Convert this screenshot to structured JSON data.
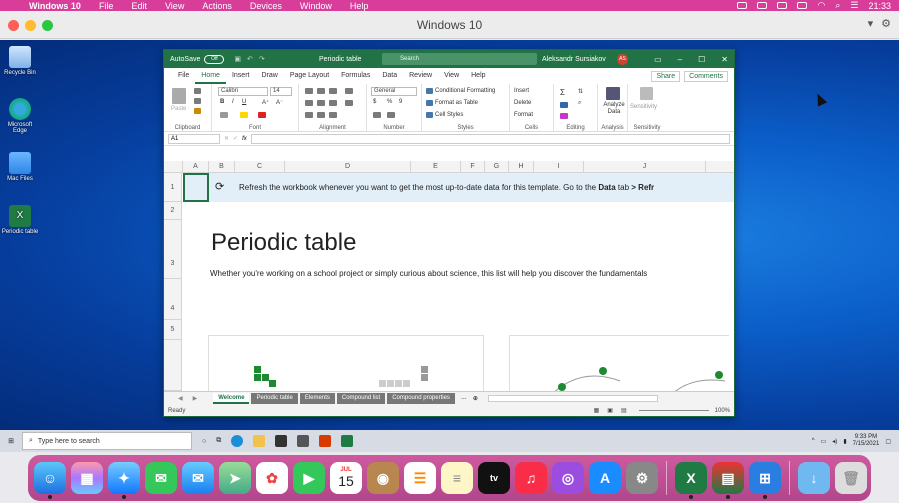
{
  "mac_menubar": {
    "app": "Windows 10",
    "menus": [
      "File",
      "Edit",
      "View",
      "Actions",
      "Devices",
      "Window",
      "Help"
    ],
    "time": "21:33"
  },
  "vm_window": {
    "title": "Windows 10"
  },
  "desktop_icons": [
    "Recycle Bin",
    "Microsoft Edge",
    "Mac Files",
    "Periodic table"
  ],
  "excel": {
    "autosave": "AutoSave",
    "autosave_state": "Off",
    "file_name": "Periodic table",
    "search_placeholder": "Search",
    "user": "Aleksandr Sursiakov",
    "user_initials": "AS",
    "tabs": [
      "File",
      "Home",
      "Insert",
      "Draw",
      "Page Layout",
      "Formulas",
      "Data",
      "Review",
      "View",
      "Help"
    ],
    "active_tab": "Home",
    "share": "Share",
    "comments": "Comments",
    "ribbon": {
      "paste": "Paste",
      "font_name": "Calibri",
      "font_size": "14",
      "number_format": "General",
      "conditional_formatting": "Conditional Formatting",
      "format_as_table": "Format as Table",
      "cell_styles": "Cell Styles",
      "insert": "Insert",
      "delete": "Delete",
      "format": "Format",
      "analyze_data": "Analyze Data",
      "sensitivity": "Sensitivity",
      "groups": [
        "Clipboard",
        "Font",
        "Alignment",
        "Number",
        "Styles",
        "Cells",
        "Editing",
        "Analysis",
        "Sensitivity"
      ]
    },
    "name_box": "A1",
    "columns": [
      "A",
      "B",
      "C",
      "D",
      "E",
      "F",
      "G",
      "H",
      "I",
      "J"
    ],
    "rows": [
      "1",
      "2",
      "3",
      "4",
      "5"
    ],
    "banner_text": "Refresh the workbook whenever you want to get the most up-to-date data for this template. Go to the",
    "banner_bold": "Data",
    "banner_tail": "tab",
    "banner_cut": "> Refr",
    "title": "Periodic table",
    "subtitle": "Whether you're working on a school project or simply curious about science, this list will help you discover the fundamentals",
    "sheet_tabs": [
      "Welcome",
      "Periodic table",
      "Elements",
      "Compound list",
      "Compound properties"
    ],
    "active_sheet": "Welcome",
    "status": "Ready",
    "zoom": "100%"
  },
  "taskbar": {
    "search_placeholder": "Type here to search",
    "time": "9:33 PM",
    "date": "7/15/2021"
  },
  "dock": {
    "calendar_month": "JUL",
    "calendar_day": "15"
  }
}
